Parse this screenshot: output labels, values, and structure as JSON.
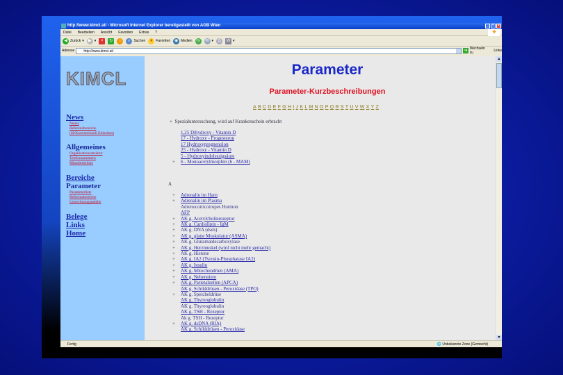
{
  "window": {
    "title": "http://www.kimcl.at/ - Microsoft Internet Explorer bereitgestellt von AGB Wien"
  },
  "menu": [
    "Datei",
    "Bearbeiten",
    "Ansicht",
    "Favoriten",
    "Extras",
    "?"
  ],
  "toolbar": {
    "back": "Zurück",
    "search": "Suchen",
    "favorites": "Favoriten",
    "media": "Medien"
  },
  "address": {
    "label": "Adresse",
    "value": "http://www.kimcl.at/",
    "go": "Wechseln zu",
    "links": "Links"
  },
  "sidebar": {
    "logo": "KIMCL",
    "news": {
      "title": "News",
      "items": [
        "Neues",
        "Referenzbereiche",
        "(SI/Konventionell Einheiten)"
      ]
    },
    "allgemeines": {
      "title": "Allgemeines",
      "items": [
        "Organisationsstruktur",
        "Telefonnummern",
        "Mitarbeiterliste"
      ]
    },
    "bereiche": "Bereiche",
    "parameter": {
      "title": "Parameter",
      "items": [
        "Parameterliste",
        "Referenzbereiche",
        "Umrechnungstabelle"
      ]
    },
    "belege": "Belege",
    "links": "Links",
    "home": "Home"
  },
  "main": {
    "title": "Parameter",
    "subtitle": "Parameter-Kurzbeschreibungen",
    "alphabet": [
      "A",
      "B",
      "C",
      "D",
      "E",
      "F",
      "G",
      "H",
      "I",
      "J",
      "K",
      "L",
      "M",
      "N",
      "O",
      "P",
      "Q",
      "R",
      "S",
      "T",
      "U",
      "V",
      "W",
      "X",
      "Y",
      "Z"
    ],
    "note_marker": "+",
    "note": "Spezialuntersuchung, wird auf Krankenschein erbracht",
    "numeric": [
      {
        "p": "",
        "t": "1,25 Dihydroxy - Vitamin D",
        "link": true
      },
      {
        "p": "",
        "t": "17 - Hydroxy - Progesteron",
        "link": true
      },
      {
        "p": "",
        "t": "17 Hydroxypregnenolon",
        "link": true
      },
      {
        "p": "",
        "t": "25 - Hydroxy - Vitamin D",
        "link": true
      },
      {
        "p": "",
        "t": "5 - Hydroxyindolessigsäure",
        "link": true
      },
      {
        "p": "+",
        "t": "6 - Monoacetylmorphin (6 - MAM)",
        "link": true
      }
    ],
    "letter_a": "A",
    "a_items": [
      {
        "p": "+",
        "t": "Adrenalin im Harn",
        "link": true
      },
      {
        "p": "+",
        "t": "Adrenalin im Plasma",
        "link": true
      },
      {
        "p": "",
        "t": "Adrenocorticotropes Hormon",
        "link": false
      },
      {
        "p": "",
        "t": "AFP",
        "link": true
      },
      {
        "p": "+",
        "t": "AK g. Acetylcholinrezeptor",
        "link": true
      },
      {
        "p": "+",
        "t": "AK g. Cardiolipin - IgM",
        "link": true
      },
      {
        "p": "+",
        "t": "AK g. DNA (dsds)",
        "link": false
      },
      {
        "p": "+",
        "t": "AK g. glatte Muskulatur (ASMA)",
        "link": true
      },
      {
        "p": "+",
        "t": "AK g. Glutamatdecarboxylase",
        "link": false
      },
      {
        "p": "+",
        "t": "AK g. Herzmuskel (wird nicht mehr gemacht)",
        "link": true
      },
      {
        "p": "+",
        "t": "AK g. Histone",
        "link": false
      },
      {
        "p": "+",
        "t": "AK g. IA2 (Tyrosin-Phosphatase IA2)",
        "link": true
      },
      {
        "p": "+",
        "t": "AK g. Insulin",
        "link": true
      },
      {
        "p": "+",
        "t": "AK g. Mitochondrien (AMA)",
        "link": true
      },
      {
        "p": "+",
        "t": "AK g. Nebenniere",
        "link": true
      },
      {
        "p": "+",
        "t": "AK g. Parietalzellen (APCA)",
        "link": true
      },
      {
        "p": "",
        "t": "AK g. Schilddrüsen - Peroxidase (TPO)",
        "link": true
      },
      {
        "p": "+",
        "t": "AK g. Speicheldrüse",
        "link": false
      },
      {
        "p": "",
        "t": "AK g. Thyreoglobulin",
        "link": true
      },
      {
        "p": "",
        "t": "AK g. Thyreoglobulin",
        "link": false
      },
      {
        "p": "",
        "t": "AK g. TSH - Rezeptor",
        "link": true
      },
      {
        "p": "",
        "t": "Ak g. TSH - Rezeptor",
        "link": false
      },
      {
        "p": "+",
        "t": "AK g. dsDNA (RIA)",
        "link": true
      },
      {
        "p": "",
        "t": "AK g. Schilddrüsen - Peroxidase",
        "link": true
      }
    ]
  },
  "status": {
    "text": "Fertig",
    "zone": "Unbekannte Zone (Gemischt)"
  }
}
